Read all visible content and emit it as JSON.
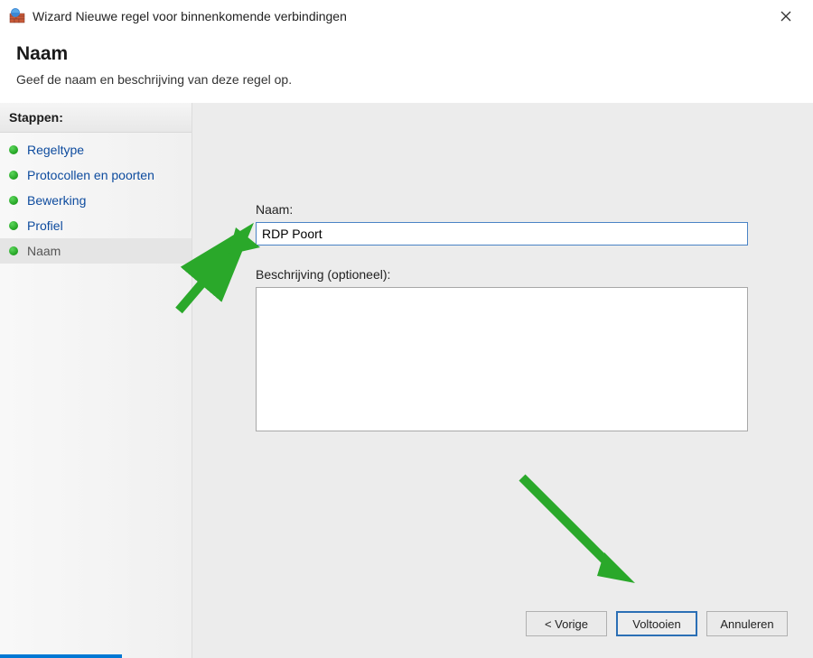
{
  "window": {
    "title": "Wizard Nieuwe regel voor binnenkomende verbindingen"
  },
  "header": {
    "heading": "Naam",
    "subtitle": "Geef de naam en beschrijving van deze regel op."
  },
  "sidebar": {
    "heading": "Stappen:",
    "items": [
      {
        "label": "Regeltype",
        "active": false
      },
      {
        "label": "Protocollen en poorten",
        "active": false
      },
      {
        "label": "Bewerking",
        "active": false
      },
      {
        "label": "Profiel",
        "active": false
      },
      {
        "label": "Naam",
        "active": true
      }
    ]
  },
  "form": {
    "name_label": "Naam:",
    "name_value": "RDP Poort",
    "description_label": "Beschrijving (optioneel):",
    "description_value": ""
  },
  "buttons": {
    "back": "< Vorige",
    "finish": "Voltooien",
    "cancel": "Annuleren"
  },
  "colors": {
    "accent": "#0078d4",
    "link": "#0d4b9e",
    "arrow": "#2aa82a"
  }
}
